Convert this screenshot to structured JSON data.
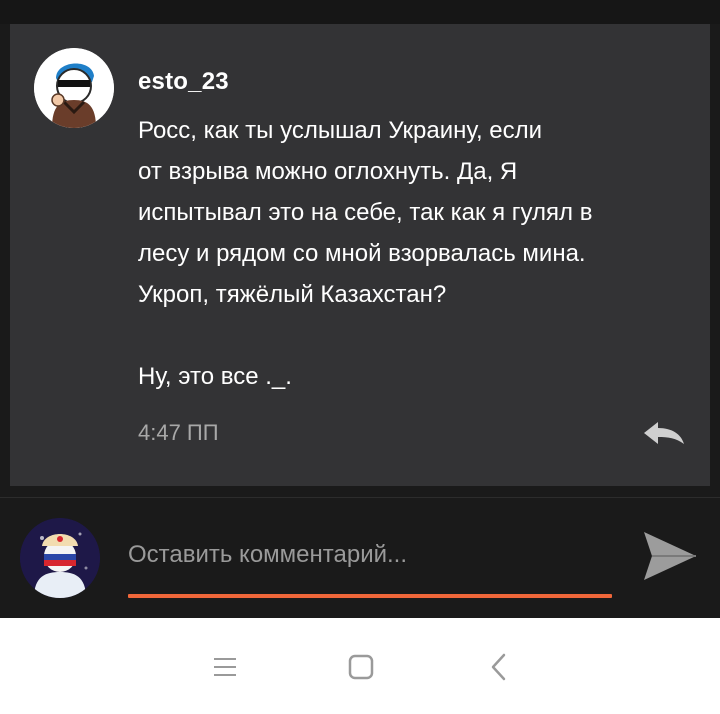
{
  "comment": {
    "username": "esto_23",
    "text": "Росс, как ты услышал Украину, если\nот взрыва можно оглохнуть. Да, Я\nиспытывал это на себе, так как я гулял в\nлесу и рядом со мной взорвалась мина.\nУкроп, тяжёлый Казахстан?\n\nНу, это все ._.",
    "timestamp": "4:47 ПП",
    "reply_icon": "reply-arrow-icon"
  },
  "composer": {
    "placeholder": "Оставить комментарий...",
    "value": "",
    "send_icon": "send-icon",
    "accent_color": "#f0673a"
  },
  "navbar": {
    "menu_icon": "menu-icon",
    "home_icon": "home-square-icon",
    "back_icon": "back-chevron-icon"
  },
  "colors": {
    "background": "#1a1a1a",
    "card": "#333335",
    "text": "#ffffff",
    "muted": "#a8a8a8"
  }
}
